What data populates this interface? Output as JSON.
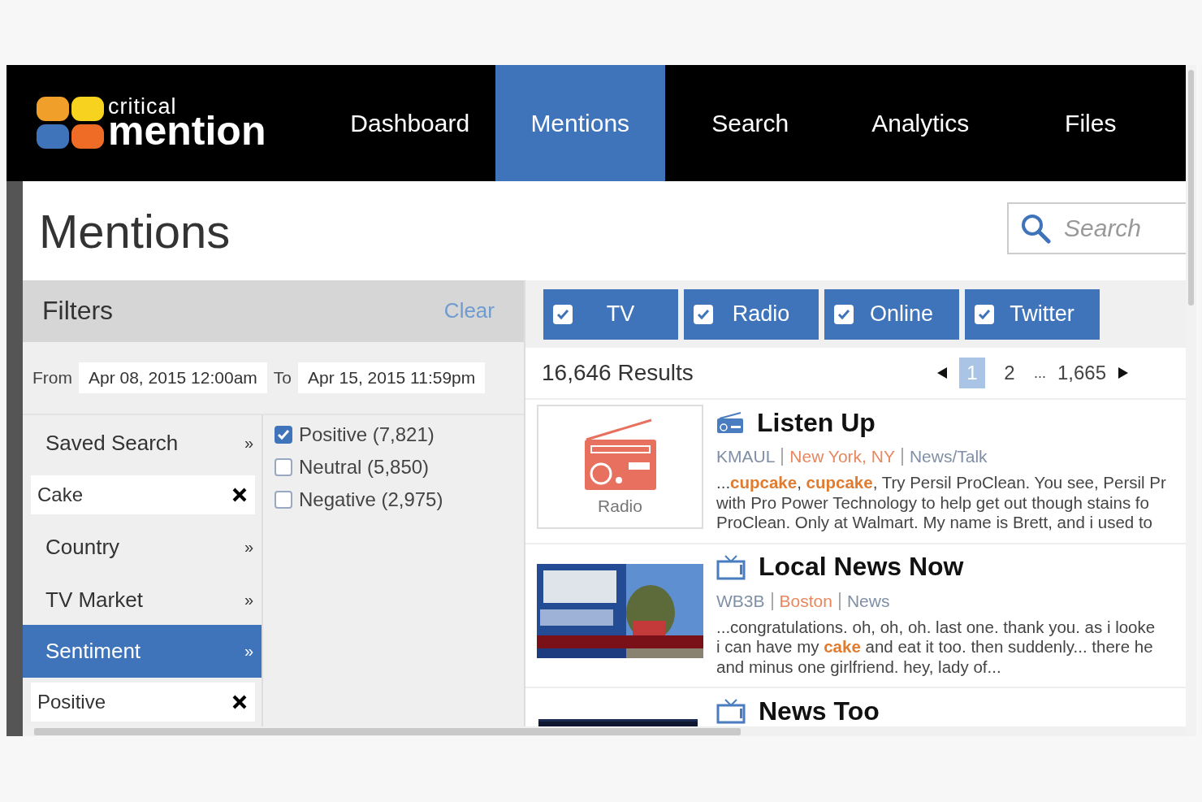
{
  "nav": {
    "logo": {
      "top": "critical",
      "bottom": "mention"
    },
    "items": [
      {
        "label": "Dashboard",
        "selected": false
      },
      {
        "label": "Mentions",
        "selected": true
      },
      {
        "label": "Search",
        "selected": false
      },
      {
        "label": "Analytics",
        "selected": false
      },
      {
        "label": "Files",
        "selected": false
      }
    ]
  },
  "page_title": "Mentions",
  "search": {
    "placeholder": "Search"
  },
  "filters": {
    "title": "Filters",
    "clear": "Clear",
    "from": {
      "label": "From",
      "value": "Apr 08, 2015 12:00am"
    },
    "to": {
      "label": "To",
      "value": "Apr 15, 2015 11:59pm"
    },
    "categories": [
      {
        "kind": "nav",
        "label": "Saved Search",
        "chevron": "»",
        "selected": false
      },
      {
        "kind": "tag",
        "label": "Cake"
      },
      {
        "kind": "nav",
        "label": "Country",
        "chevron": "»",
        "selected": false
      },
      {
        "kind": "nav",
        "label": "TV Market",
        "chevron": "»",
        "selected": false
      },
      {
        "kind": "nav",
        "label": "Sentiment",
        "chevron": "»",
        "selected": true
      },
      {
        "kind": "tag",
        "label": "Positive"
      }
    ],
    "sentiments": [
      {
        "label": "Positive (7,821)",
        "checked": true
      },
      {
        "label": "Neutral (5,850)",
        "checked": false
      },
      {
        "label": "Negative (2,975)",
        "checked": false
      }
    ]
  },
  "source_tabs": [
    {
      "label": "TV",
      "checked": true
    },
    {
      "label": "Radio",
      "checked": true
    },
    {
      "label": "Online",
      "checked": true
    },
    {
      "label": "Twitter",
      "checked": true
    }
  ],
  "results": {
    "count": "16,646 Results",
    "pages": [
      {
        "label": "1",
        "selected": true
      },
      {
        "label": "2",
        "selected": false
      }
    ],
    "ellipsis": "...",
    "last_page": "1,665",
    "items": [
      {
        "title": "Listen Up",
        "kind": "radio",
        "thumbnail": {
          "kind": "icon",
          "label": "Radio"
        },
        "station": "KMAUL",
        "location": "New York, NY",
        "genre": "News/Talk",
        "snippet": [
          "...**cupcake**, **cupcake**, Try Persil ProClean. You see, Persil Pr",
          "with Pro Power Technology to help get out though stains fo",
          "ProClean. Only at Walmart. My name is Brett, and i used to"
        ]
      },
      {
        "title": "Local News Now",
        "kind": "tv",
        "thumbnail": {
          "kind": "picture"
        },
        "station": "WB3B",
        "location": "Boston",
        "genre": "News",
        "snippet": [
          "...congratulations. oh, oh, oh. last one. thank you. as i looke",
          "i can have my **cake** and eat it too. then suddenly... there he",
          "and minus one girlfriend. hey, lady of..."
        ]
      },
      {
        "title": "News Too",
        "kind": "tv",
        "thumbnail": {
          "kind": "picture"
        }
      }
    ]
  }
}
